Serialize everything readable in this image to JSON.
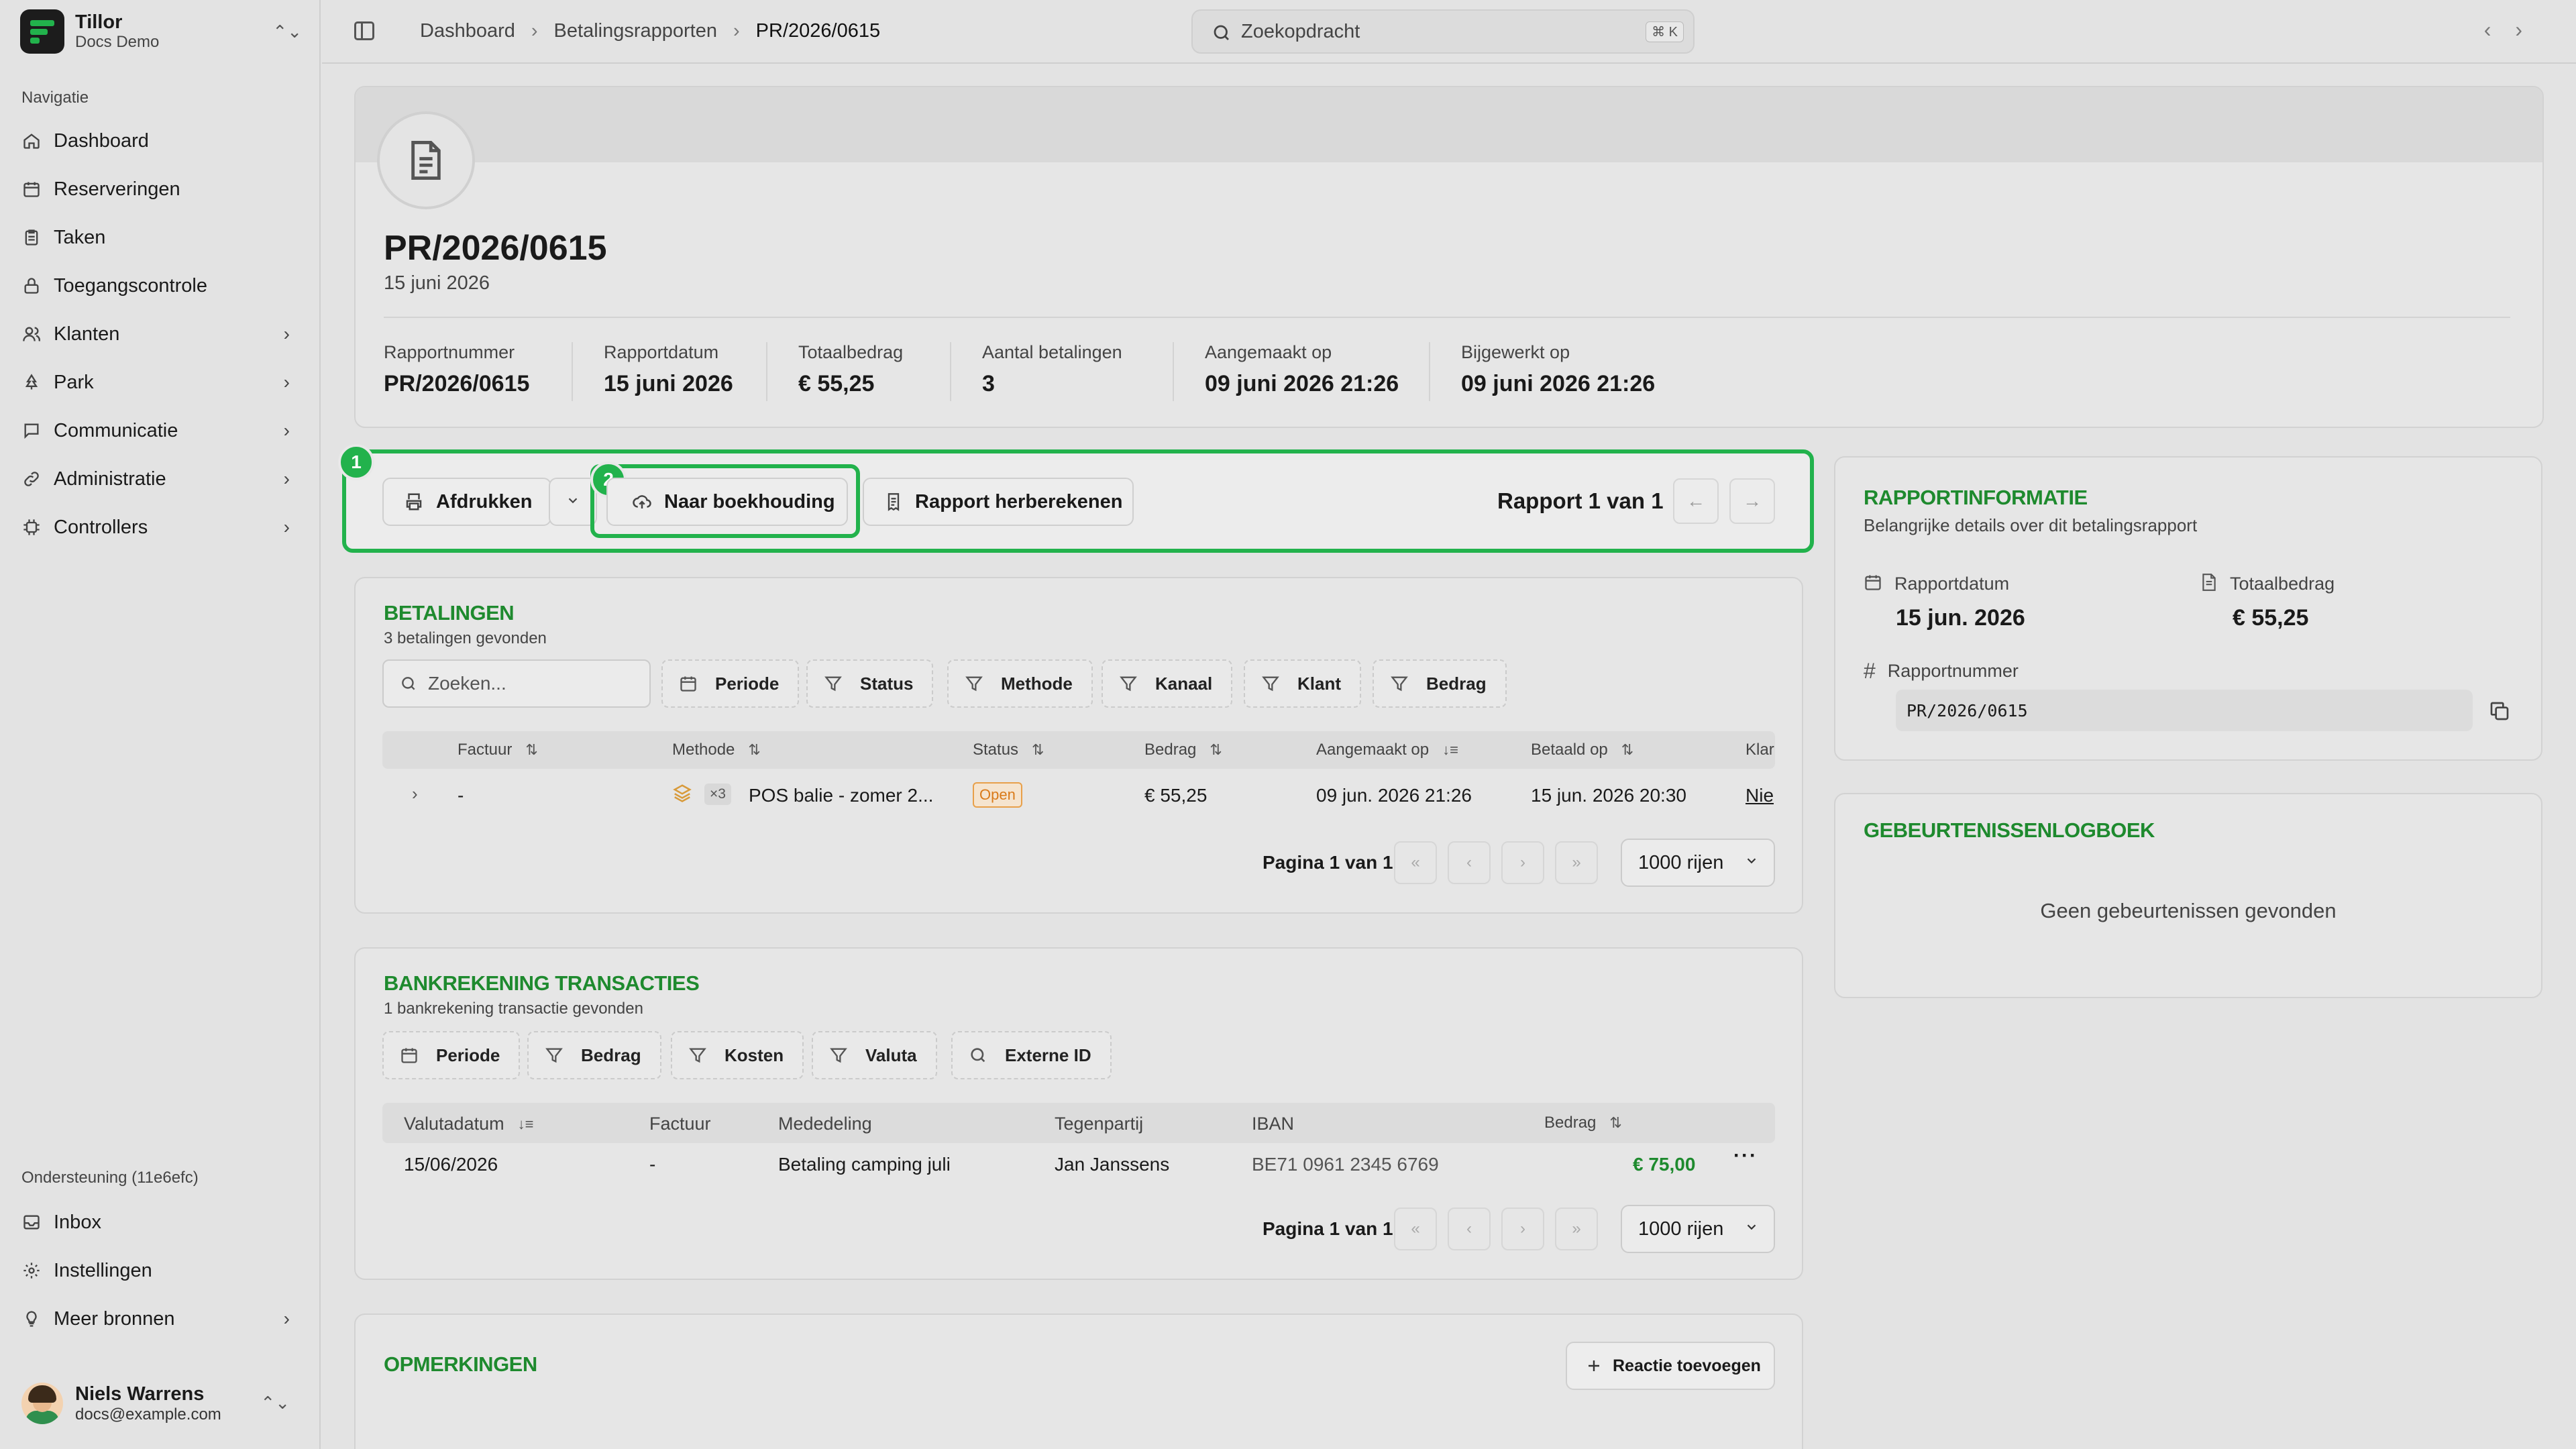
{
  "brand": {
    "name": "Tillor",
    "sub": "Docs Demo"
  },
  "sidebar": {
    "heading": "Navigatie",
    "items": [
      {
        "label": "Dashboard",
        "icon": "home-icon"
      },
      {
        "label": "Reserveringen",
        "icon": "calendar-icon"
      },
      {
        "label": "Taken",
        "icon": "clipboard-icon"
      },
      {
        "label": "Toegangscontrole",
        "icon": "lock-icon"
      },
      {
        "label": "Klanten",
        "icon": "users-icon"
      },
      {
        "label": "Park",
        "icon": "park-icon"
      },
      {
        "label": "Communicatie",
        "icon": "message-icon"
      },
      {
        "label": "Administratie",
        "icon": "link-icon"
      },
      {
        "label": "Controllers",
        "icon": "chip-icon"
      }
    ],
    "support_heading": "Ondersteuning (11e6efc)",
    "support_items": [
      {
        "label": "Inbox",
        "icon": "inbox-icon"
      },
      {
        "label": "Instellingen",
        "icon": "gear-icon"
      },
      {
        "label": "Meer bronnen",
        "icon": "lightbulb-icon"
      }
    ],
    "user": {
      "name": "Niels Warrens",
      "email": "docs@example.com"
    }
  },
  "topbar": {
    "breadcrumbs": [
      "Dashboard",
      "Betalingsrapporten",
      "PR/2026/0615"
    ],
    "search_placeholder": "Zoekopdracht",
    "shortcut": "⌘ K"
  },
  "report": {
    "title": "PR/2026/0615",
    "date": "15 juni 2026",
    "meta": [
      {
        "label": "Rapportnummer",
        "value": "PR/2026/0615"
      },
      {
        "label": "Rapportdatum",
        "value": "15 juni 2026"
      },
      {
        "label": "Totaalbedrag",
        "value": "€ 55,25"
      },
      {
        "label": "Aantal betalingen",
        "value": "3"
      },
      {
        "label": "Aangemaakt op",
        "value": "09 juni 2026 21:26"
      },
      {
        "label": "Bijgewerkt op",
        "value": "09 juni 2026 21:26"
      }
    ]
  },
  "actions": {
    "print": "Afdrukken",
    "accounting": "Naar boekhouding",
    "recalc": "Rapport herberekenen",
    "pager": "Rapport 1 van 1",
    "marker1": "1",
    "marker2": "2"
  },
  "payments": {
    "title": "BETALINGEN",
    "subtitle": "3 betalingen gevonden",
    "search_placeholder": "Zoeken...",
    "filters": [
      "Periode",
      "Status",
      "Methode",
      "Kanaal",
      "Klant",
      "Bedrag"
    ],
    "columns": [
      "Factuur",
      "Methode",
      "Status",
      "Bedrag",
      "Aangemaakt op",
      "Betaald op",
      "Klar"
    ],
    "row": {
      "factuur": "-",
      "count": "×3",
      "methode": "POS balie - zomer 2...",
      "status": "Open",
      "bedrag": "€ 55,25",
      "aangemaakt": "09 jun. 2026 21:26",
      "betaald": "15 jun. 2026 20:30",
      "klant": "Nie"
    },
    "page_info": "Pagina 1 van 1",
    "rows": "1000 rijen"
  },
  "bank": {
    "title": "BANKREKENING TRANSACTIES",
    "subtitle": "1 bankrekening transactie gevonden",
    "filters": [
      "Periode",
      "Bedrag",
      "Kosten",
      "Valuta",
      "Externe ID"
    ],
    "columns": [
      "Valutadatum",
      "Factuur",
      "Mededeling",
      "Tegenpartij",
      "IBAN",
      "Bedrag"
    ],
    "row": {
      "date": "15/06/2026",
      "factuur": "-",
      "mededeling": "Betaling camping juli",
      "tegenpartij": "Jan Janssens",
      "iban": "BE71 0961 2345 6769",
      "bedrag": "€ 75,00"
    },
    "page_info": "Pagina 1 van 1",
    "rows": "1000 rijen"
  },
  "remarks": {
    "title": "OPMERKINGEN",
    "add_button": "Reactie toevoegen"
  },
  "info": {
    "title": "RAPPORTINFORMATIE",
    "subtitle": "Belangrijke details over dit betalingsrapport",
    "date_label": "Rapportdatum",
    "date_value": "15 jun. 2026",
    "total_label": "Totaalbedrag",
    "total_value": "€ 55,25",
    "number_label": "Rapportnummer",
    "number_value": "PR/2026/0615"
  },
  "events": {
    "title": "GEBEURTENISSENLOGBOEK",
    "empty": "Geen gebeurtenissen gevonden"
  },
  "colors": {
    "accent": "#1e8a2e",
    "highlight": "#22b24c"
  }
}
